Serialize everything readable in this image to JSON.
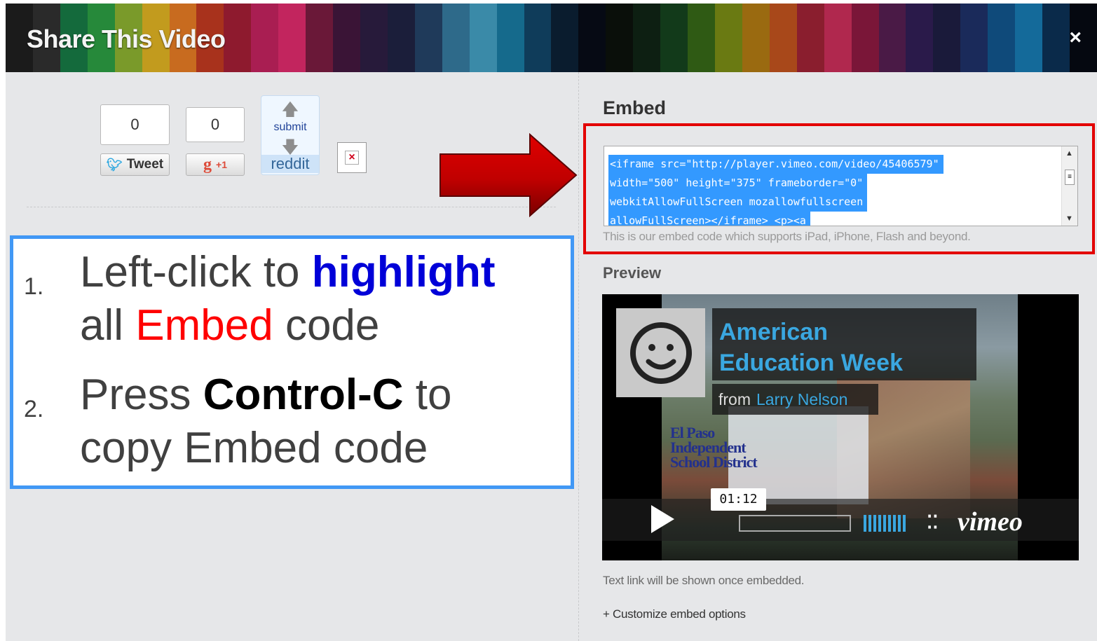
{
  "header": {
    "title": "Share This Video",
    "close_label": "×",
    "stripe_colors": [
      "#1b1b1b",
      "#2a2a2a",
      "#146a3c",
      "#26893a",
      "#7a9a2a",
      "#c29b1e",
      "#c86b1f",
      "#a8321c",
      "#8e1a2e",
      "#a91e52",
      "#c2255e",
      "#6a1838",
      "#3a1436",
      "#271a3a",
      "#1b1e3a",
      "#1f3a5a",
      "#2e6a8a",
      "#3a8aa8",
      "#156a8c",
      "#0f3c5a",
      "#0a1c2e",
      "#060a14",
      "#0a0f0a",
      "#0d1f12",
      "#123a1a",
      "#2f5a14",
      "#6a7a12",
      "#9a6a10",
      "#a8481a",
      "#8a1e2e",
      "#b0284e",
      "#7a1638",
      "#4a1a46",
      "#2a1a4a",
      "#1a1a3a",
      "#1a2a5a",
      "#0f4a7a",
      "#146a9a",
      "#0a2a4a",
      "#050810"
    ]
  },
  "share": {
    "tweet_count": "0",
    "tweet_label": "Tweet",
    "gplus_count": "0",
    "gplus_icon": "g",
    "gplus_label": "+1",
    "reddit_submit": "submit",
    "reddit_label": "reddit",
    "broken_image_icon": "×"
  },
  "instructions": {
    "step1_num": "1.",
    "step1_part1": "Left-click to ",
    "step1_highlight": "highlight",
    "step1_line2_prefix": "all ",
    "step1_embed": "Embed",
    "step1_line2_suffix": " code",
    "step2_num": "2.",
    "step2_part1": "Press ",
    "step2_key": "Control-C",
    "step2_part2": " to",
    "step2_line2": "copy Embed code",
    "colors": {
      "blue": "#0000d8",
      "red": "#ff0000",
      "border": "#4198f5"
    }
  },
  "embed": {
    "heading": "Embed",
    "code_lines": [
      "<iframe src=\"http://player.vimeo.com/video/45406579\"",
      "width=\"500\" height=\"375\" frameborder=\"0\"",
      "webkitAllowFullScreen mozallowfullscreen",
      "allowFullScreen></iframe> <p><a"
    ],
    "help_text": "This is our embed code which supports iPad, iPhone, Flash and beyond.",
    "highlight_color": "#e30000"
  },
  "preview": {
    "heading": "Preview",
    "video_title_line1": "American",
    "video_title_line2": "Education Week",
    "byline_prefix": "from",
    "byline_author": "Larry Nelson",
    "school_line1": "El Paso",
    "school_line2": "Independent",
    "school_line3": "School District",
    "timestamp": "01:12",
    "vimeo_logo": "vimeo",
    "fullscreen_icon": "⁚⁚"
  },
  "footer": {
    "text_link_note": "Text link will be shown once embedded.",
    "customize_link": "+ Customize embed options"
  }
}
